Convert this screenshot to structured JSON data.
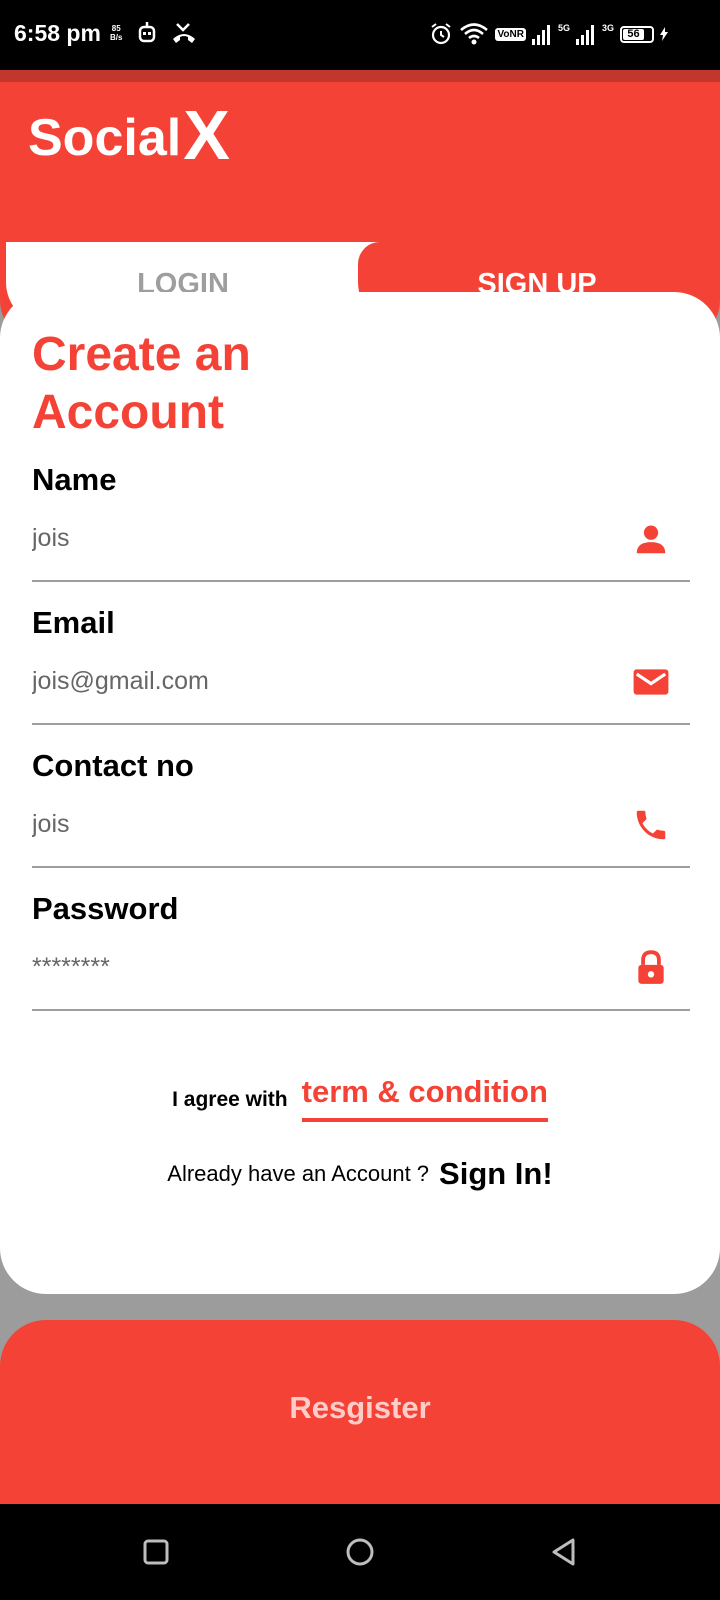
{
  "status_bar": {
    "time": "6:58 pm",
    "speed_value": "85",
    "speed_unit": "B/s",
    "vonr": "VoNR",
    "net1": "5G",
    "net2": "3G",
    "battery": "56"
  },
  "header": {
    "logo_text": "Social",
    "logo_accent": "X"
  },
  "tabs": {
    "login": "LOGIN",
    "signup": "SIGN UP"
  },
  "form": {
    "title": "Create an Account",
    "name": {
      "label": "Name",
      "value": "jois",
      "icon": "person-icon"
    },
    "email": {
      "label": "Email",
      "value": "jois@gmail.com",
      "icon": "mail-icon"
    },
    "contact": {
      "label": "Contact no",
      "value": "jois",
      "icon": "phone-icon"
    },
    "password": {
      "label": "Password",
      "value": "********",
      "icon": "lock-icon"
    },
    "agree_text": "I agree with",
    "agree_link": "term & condition",
    "already_text": "Already have an Account ?",
    "signin_link": "Sign In!"
  },
  "register": {
    "label": "Resgister"
  },
  "colors": {
    "primary": "#f44336",
    "background": "#9c9c9c",
    "register_text": "#ffcdc9"
  }
}
